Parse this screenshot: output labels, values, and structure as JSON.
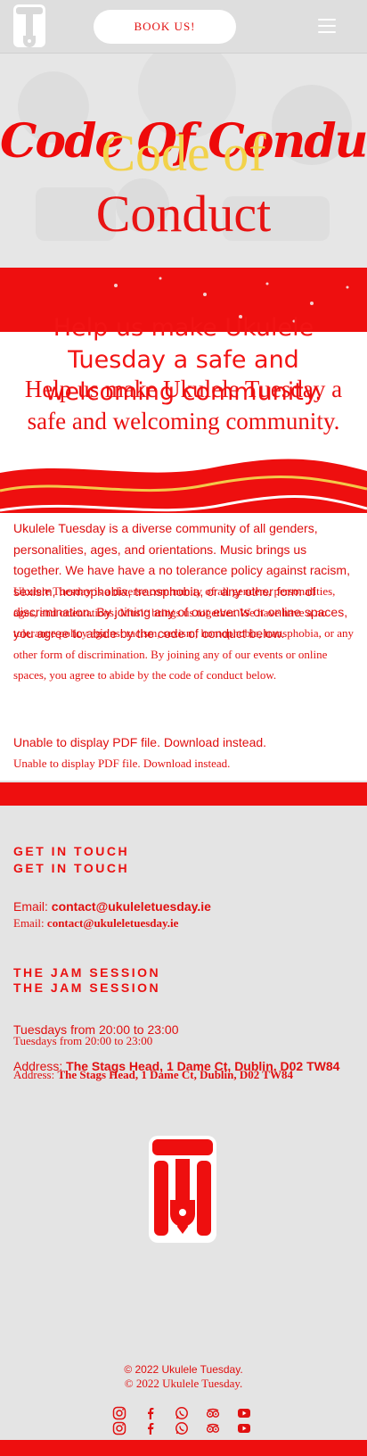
{
  "header": {
    "book_label": "BOOK US!",
    "logo": "ukulele-tuesday-logo",
    "menu_icon": "hamburger-menu-icon"
  },
  "hero": {
    "title_script": "Code Of Conduct",
    "title_word_1": "Code of",
    "title_word_2": "Conduct"
  },
  "tagline": {
    "line_a": "Help us make Ukulele Tuesday a safe and welcoming community.",
    "line_b": "Help us make Ukulele Tuesday a safe and welcoming community."
  },
  "body": {
    "para_a": "Ukulele Tuesday is a diverse community of all genders, personalities, ages, and orientations. Music brings us together. We have have a no tolerance policy against racism, sexism, homophobia, transphobia, or any other form of discrimination. By joining any of our events or online spaces, you agree to abide by the code of conduct below.",
    "para_b": "Ukulele Tuesday is a diverse community of all genders, personalities, ages, and orientations. Music brings us together. We have have a no tolerance policy against racism, sexism, homophobia, transphobia, or any other form of discrimination. By joining any of our events or online spaces, you agree to abide by the code of conduct below.",
    "pdf_a": "Unable to display PDF file. Download instead.",
    "pdf_b": "Unable to display PDF file. Download instead."
  },
  "footer": {
    "contact_heading": "GET IN TOUCH",
    "email_label": "Email: ",
    "email": "contact@ukuleletuesday.ie",
    "jam_heading": "THE JAM SESSION",
    "times": "Tuesdays from 20:00 to 23:00",
    "address_label": "Address: ",
    "address": "The Stags Head, 1 Dame Ct, Dublin, D02 TW84",
    "copyright": "© 2022 Ukulele Tuesday.",
    "social_icons": [
      "instagram-icon",
      "facebook-icon",
      "whatsapp-icon",
      "tripadvisor-icon",
      "youtube-icon"
    ]
  },
  "colors": {
    "accent_red": "#ee0f0f",
    "gold": "#f2d24a",
    "background": "#e4e4e4"
  }
}
